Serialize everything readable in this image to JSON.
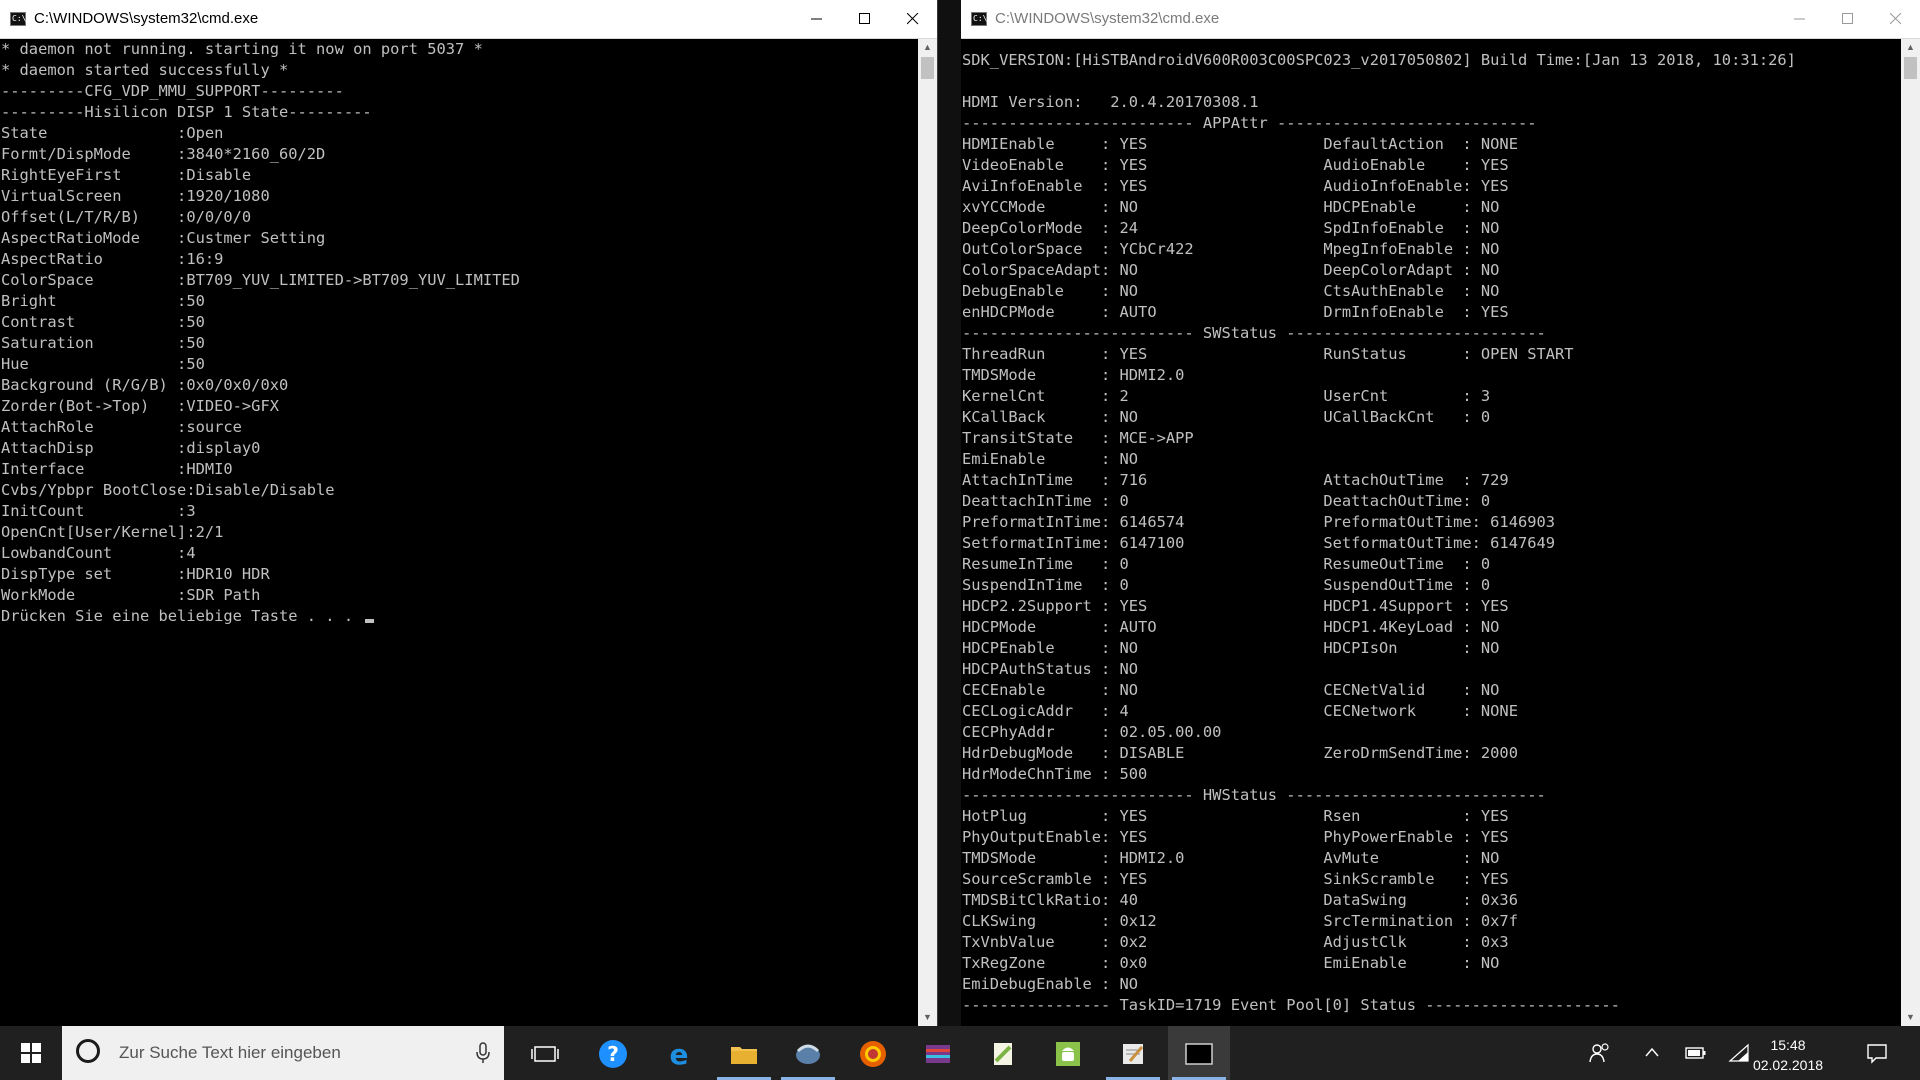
{
  "left_window": {
    "title": "C:\\WINDOWS\\system32\\cmd.exe",
    "lines": [
      "* daemon not running. starting it now on port 5037 *",
      "* daemon started successfully *",
      "---------CFG_VDP_MMU_SUPPORT---------",
      "---------Hisilicon DISP 1 State---------",
      "State              :Open",
      "Formt/DispMode     :3840*2160_60/2D",
      "RightEyeFirst      :Disable",
      "VirtualScreen      :1920/1080",
      "Offset(L/T/R/B)    :0/0/0/0",
      "AspectRatioMode    :Custmer Setting",
      "AspectRatio        :16:9",
      "ColorSpace         :BT709_YUV_LIMITED->BT709_YUV_LIMITED",
      "Bright             :50",
      "Contrast           :50",
      "Saturation         :50",
      "Hue                :50",
      "Background (R/G/B) :0x0/0x0/0x0",
      "Zorder(Bot->Top)   :VIDEO->GFX",
      "AttachRole         :source",
      "AttachDisp         :display0",
      "Interface          :HDMI0",
      "Cvbs/Ypbpr BootClose:Disable/Disable",
      "InitCount          :3",
      "OpenCnt[User/Kernel]:2/1",
      "LowbandCount       :4",
      "DispType set       :HDR10 HDR",
      "WorkMode           :SDR Path"
    ],
    "prompt": "Drücken Sie eine beliebige Taste . . . "
  },
  "right_window": {
    "title": "C:\\WINDOWS\\system32\\cmd.exe",
    "lines": [
      "SDK_VERSION:[HiSTBAndroidV600R003C00SPC023_v2017050802] Build Time:[Jan 13 2018, 10:31:26]",
      "",
      "HDMI Version:   2.0.4.20170308.1",
      "------------------------- APPAttr ----------------------------",
      "HDMIEnable     : YES                   DefaultAction  : NONE",
      "VideoEnable    : YES                   AudioEnable    : YES",
      "AviInfoEnable  : YES                   AudioInfoEnable: YES",
      "xvYCCMode      : NO                    HDCPEnable     : NO",
      "DeepColorMode  : 24                    SpdInfoEnable  : NO",
      "OutColorSpace  : YCbCr422              MpegInfoEnable : NO",
      "ColorSpaceAdapt: NO                    DeepColorAdapt : NO",
      "DebugEnable    : NO                    CtsAuthEnable  : NO",
      "enHDCPMode     : AUTO                  DrmInfoEnable  : YES",
      "------------------------- SWStatus ----------------------------",
      "ThreadRun      : YES                   RunStatus      : OPEN START",
      "TMDSMode       : HDMI2.0",
      "KernelCnt      : 2                     UserCnt        : 3",
      "KCallBack      : NO                    UCallBackCnt   : 0",
      "TransitState   : MCE->APP",
      "EmiEnable      : NO",
      "AttachInTime   : 716                   AttachOutTime  : 729",
      "DeattachInTime : 0                     DeattachOutTime: 0",
      "PreformatInTime: 6146574               PreformatOutTime: 6146903",
      "SetformatInTime: 6147100               SetformatOutTime: 6147649",
      "ResumeInTime   : 0                     ResumeOutTime  : 0",
      "SuspendInTime  : 0                     SuspendOutTime : 0",
      "HDCP2.2Support : YES                   HDCP1.4Support : YES",
      "HDCPMode       : AUTO                  HDCP1.4KeyLoad : NO",
      "HDCPEnable     : NO                    HDCPIsOn       : NO",
      "HDCPAuthStatus : NO",
      "CECEnable      : NO                    CECNetValid    : NO",
      "CECLogicAddr   : 4                     CECNetwork     : NONE",
      "CECPhyAddr     : 02.05.00.00",
      "HdrDebugMode   : DISABLE               ZeroDrmSendTime: 2000",
      "HdrModeChnTime : 500",
      "------------------------- HWStatus ----------------------------",
      "HotPlug        : YES                   Rsen           : YES",
      "PhyOutputEnable: YES                   PhyPowerEnable : YES",
      "TMDSMode       : HDMI2.0               AvMute         : NO",
      "SourceScramble : YES                   SinkScramble   : YES",
      "TMDSBitClkRatio: 40                    DataSwing      : 0x36",
      "CLKSwing       : 0x12                  SrcTermination : 0x7f",
      "TxVnbValue     : 0x2                   AdjustClk      : 0x3",
      "TxRegZone      : 0x0                   EmiEnable      : NO",
      "EmiDebugEnable : NO",
      "---------------- TaskID=1719 Event Pool[0] Status ---------------------"
    ]
  },
  "taskbar": {
    "search_placeholder": "Zur Suche Text hier eingeben",
    "apps": [
      "task-view",
      "help",
      "edge",
      "file-explorer",
      "outlook",
      "firefox",
      "media-app",
      "notepadpp",
      "android-studio",
      "notepad",
      "cmd"
    ],
    "time": "15:48",
    "date": "02.02.2018"
  },
  "colors": {
    "console_bg": "#000000",
    "console_fg": "#c0c0c0",
    "taskbar_bg": "#202020",
    "titlebar_bg": "#ffffff"
  }
}
